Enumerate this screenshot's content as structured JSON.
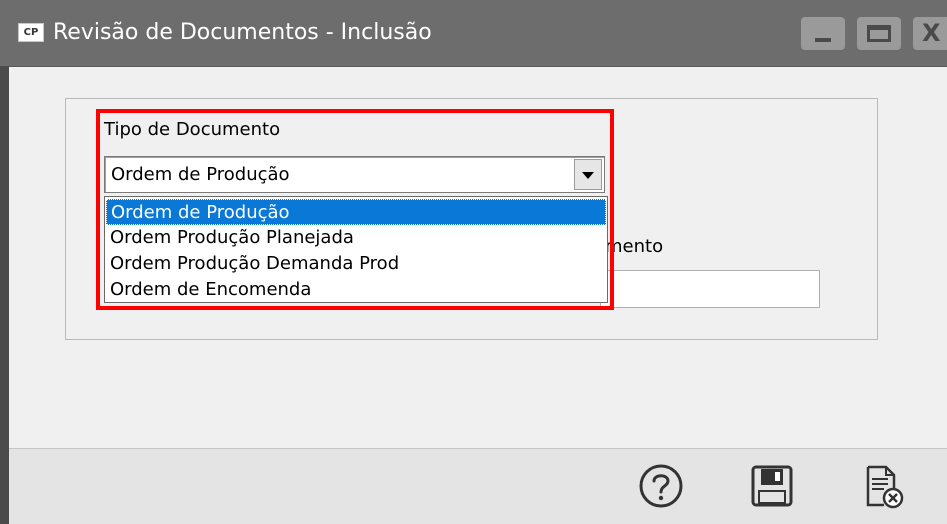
{
  "window": {
    "app_icon_text": "CP",
    "title": "Revisão de Documentos - Inclusão"
  },
  "form": {
    "tipo_label": "Tipo de Documento",
    "tipo_selected": "Ordem de Produção",
    "partial_label": "mento"
  },
  "dropdown": {
    "options": [
      "Ordem de Produção",
      "Ordem Produção Planejada",
      "Ordem Produção Demanda Prod",
      "Ordem de Encomenda"
    ]
  },
  "colors": {
    "titlebar": "#6d6d6d",
    "highlight": "#0a78d7",
    "annotation_box": "#ff0000"
  },
  "icons": [
    "help-icon",
    "save-icon",
    "cancel-document-icon"
  ]
}
